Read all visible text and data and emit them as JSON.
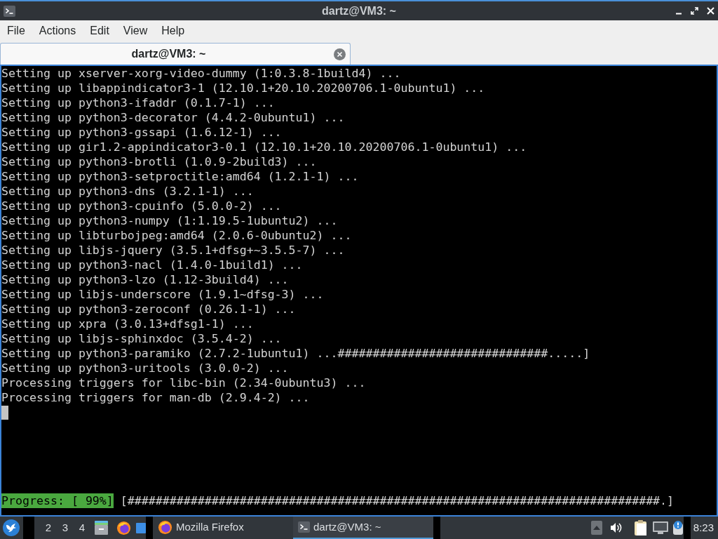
{
  "window": {
    "title": "dartz@VM3: ~"
  },
  "menu": [
    "File",
    "Actions",
    "Edit",
    "View",
    "Help"
  ],
  "tabs": [
    {
      "label": "dartz@VM3: ~",
      "selected": true
    }
  ],
  "terminal": {
    "lines": [
      "Setting up xserver-xorg-video-dummy (1:0.3.8-1build4) ...",
      "Setting up libappindicator3-1 (12.10.1+20.10.20200706.1-0ubuntu1) ...",
      "Setting up python3-ifaddr (0.1.7-1) ...",
      "Setting up python3-decorator (4.4.2-0ubuntu1) ...",
      "Setting up python3-gssapi (1.6.12-1) ...",
      "Setting up gir1.2-appindicator3-0.1 (12.10.1+20.10.20200706.1-0ubuntu1) ...",
      "Setting up python3-brotli (1.0.9-2build3) ...",
      "Setting up python3-setproctitle:amd64 (1.2.1-1) ...",
      "Setting up python3-dns (3.2.1-1) ...",
      "Setting up python3-cpuinfo (5.0.0-2) ...",
      "Setting up python3-numpy (1:1.19.5-1ubuntu2) ...",
      "Setting up libturbojpeg:amd64 (2.0.6-0ubuntu2) ...",
      "Setting up libjs-jquery (3.5.1+dfsg+~3.5.5-7) ...",
      "Setting up python3-nacl (1.4.0-1build1) ...",
      "Setting up python3-lzo (1.12-3build4) ...",
      "Setting up libjs-underscore (1.9.1~dfsg-3) ...",
      "Setting up python3-zeroconf (0.26.1-1) ...",
      "Setting up xpra (3.0.13+dfsg1-1) ...",
      "Setting up libjs-sphinxdoc (3.5.4-2) ...",
      "Setting up python3-paramiko (2.7.2-1ubuntu1) ...##############################.....]",
      "Setting up python3-uritools (3.0.0-2) ...",
      "Processing triggers for libc-bin (2.34-0ubuntu3) ...",
      "Processing triggers for man-db (2.9.4-2) ..."
    ],
    "progress": {
      "label": "Progress: [ 99%]",
      "bar": "[############################################################################.]"
    }
  },
  "taskbar": {
    "workspaces": [
      {
        "selected": true
      },
      {
        "label": "2",
        "selected": false
      },
      {
        "label": "3",
        "selected": false
      },
      {
        "label": "4",
        "selected": false
      }
    ],
    "tasks": [
      {
        "kind": "browser",
        "label": "Mozilla Firefox",
        "selected": false
      },
      {
        "kind": "terminal",
        "label": "dartz@VM3: ~",
        "selected": true
      }
    ],
    "clock": "8:23"
  }
}
